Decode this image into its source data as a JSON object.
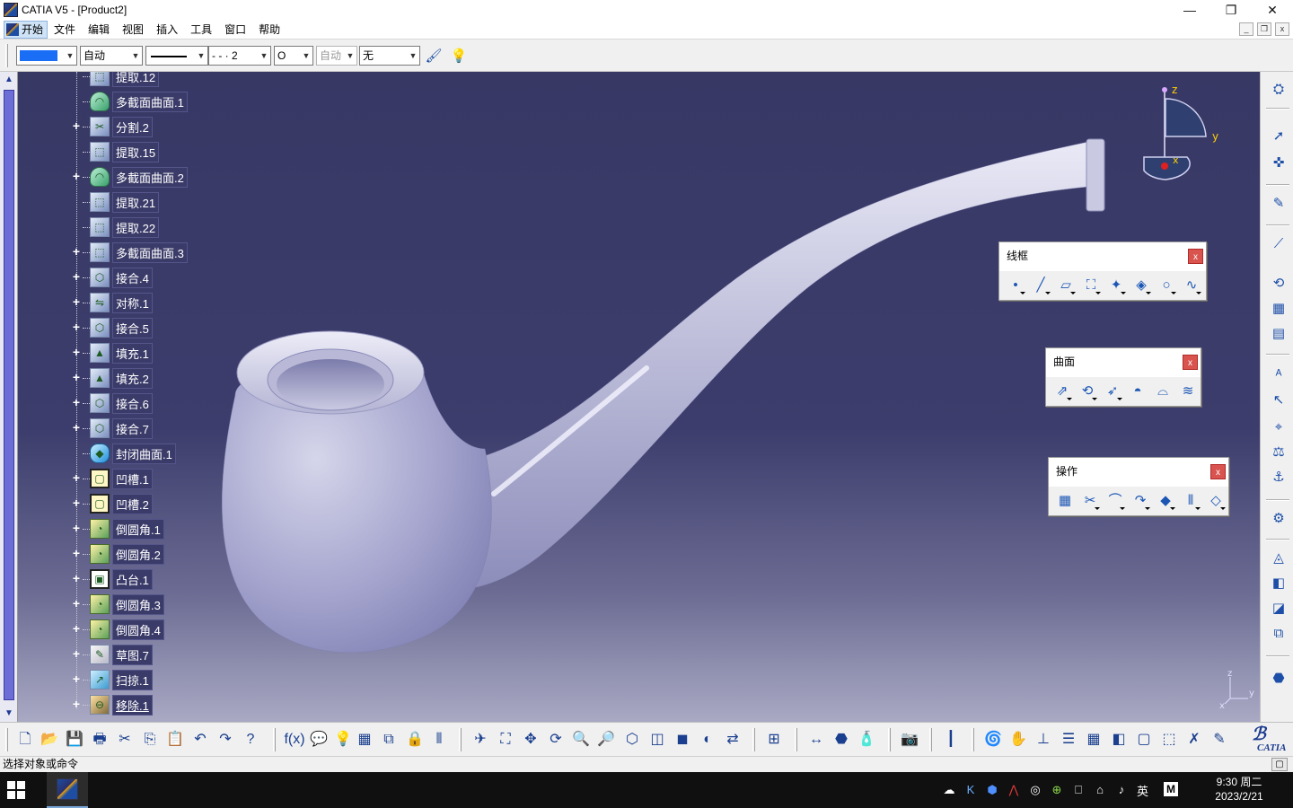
{
  "window": {
    "title": "CATIA V5 - [Product2]",
    "min": "—",
    "restore": "❐",
    "close": "✕"
  },
  "menu": {
    "items": [
      "开始",
      "文件",
      "编辑",
      "视图",
      "插入",
      "工具",
      "窗口",
      "帮助"
    ],
    "mdi": [
      "_",
      "❐",
      "x"
    ]
  },
  "properties": {
    "color": "#1a6ef5",
    "layer": "自动",
    "linetype": "- - · 2",
    "thickness": "O",
    "transparency": "自动",
    "layerfilter": "无"
  },
  "tree": [
    {
      "label": "提取.12",
      "icon": "extract",
      "expandable": false
    },
    {
      "label": "多截面曲面.1",
      "icon": "surf",
      "expandable": false
    },
    {
      "label": "分割.2",
      "icon": "split",
      "expandable": true
    },
    {
      "label": "提取.15",
      "icon": "extract",
      "expandable": false
    },
    {
      "label": "多截面曲面.2",
      "icon": "surf",
      "expandable": true
    },
    {
      "label": "提取.21",
      "icon": "extract",
      "expandable": false
    },
    {
      "label": "提取.22",
      "icon": "extract",
      "expandable": false
    },
    {
      "label": "多截面曲面.3",
      "icon": "extract",
      "expandable": true
    },
    {
      "label": "接合.4",
      "icon": "join",
      "expandable": true
    },
    {
      "label": "对称.1",
      "icon": "symmetry",
      "expandable": true
    },
    {
      "label": "接合.5",
      "icon": "join",
      "expandable": true
    },
    {
      "label": "填充.1",
      "icon": "fill",
      "expandable": true
    },
    {
      "label": "填充.2",
      "icon": "fill",
      "expandable": true
    },
    {
      "label": "接合.6",
      "icon": "join",
      "expandable": true
    },
    {
      "label": "接合.7",
      "icon": "join",
      "expandable": true
    },
    {
      "label": "封闭曲面.1",
      "icon": "closed",
      "expandable": false
    },
    {
      "label": "凹槽.1",
      "icon": "pocket",
      "expandable": true
    },
    {
      "label": "凹槽.2",
      "icon": "pocket",
      "expandable": true
    },
    {
      "label": "倒圆角.1",
      "icon": "fillet",
      "expandable": true
    },
    {
      "label": "倒圆角.2",
      "icon": "fillet",
      "expandable": true
    },
    {
      "label": "凸台.1",
      "icon": "pad",
      "expandable": true
    },
    {
      "label": "倒圆角.3",
      "icon": "fillet",
      "expandable": true
    },
    {
      "label": "倒圆角.4",
      "icon": "fillet",
      "expandable": true
    },
    {
      "label": "草图.7",
      "icon": "sketch",
      "expandable": true
    },
    {
      "label": "扫掠.1",
      "icon": "sweep",
      "expandable": true
    },
    {
      "label": "移除.1",
      "icon": "remove",
      "expandable": true
    }
  ],
  "compass": {
    "z": "z",
    "y": "y",
    "x": "x"
  },
  "axes_small": {
    "z": "z",
    "y": "y",
    "x": "x"
  },
  "floating_toolbars": {
    "wireframe": {
      "title": "线框",
      "icons": [
        "point-icon",
        "line-icon",
        "plane-icon",
        "projection-icon",
        "intersection-icon",
        "offset-icon",
        "circle-icon",
        "spline-icon"
      ]
    },
    "surfaces": {
      "title": "曲面",
      "icons": [
        "extrude-icon",
        "revolve-icon",
        "sweep-icon",
        "fill-icon",
        "multisection-icon",
        "blend-icon"
      ]
    },
    "operations": {
      "title": "操作",
      "icons": [
        "join-icon",
        "split-icon",
        "fillet-icon",
        "translate-icon",
        "extract-icon",
        "extrapolate-icon",
        "boundary-icon"
      ]
    }
  },
  "status": {
    "text": "选择对象或命令"
  },
  "taskbar": {
    "ime": "英",
    "ime_mode": "M",
    "time": "9:30 周二",
    "date": "2023/2/21"
  },
  "brand": {
    "ds": "3DS",
    "catia": "CATIA"
  }
}
